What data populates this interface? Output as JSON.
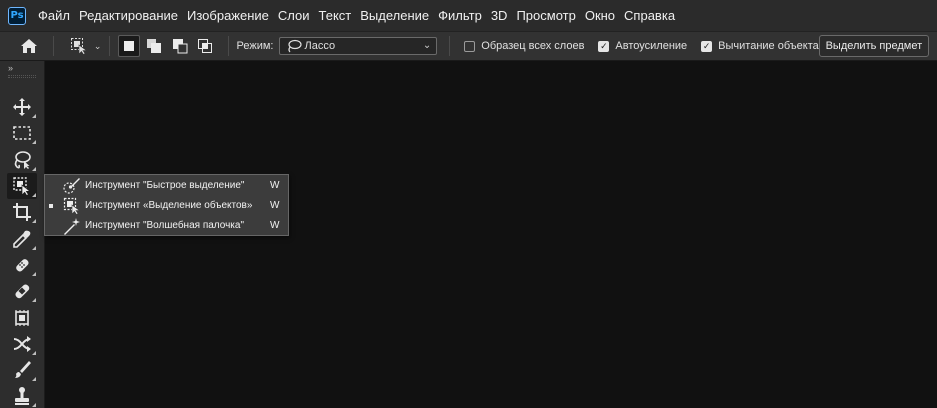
{
  "app": {
    "logo_text": "Ps"
  },
  "menu": [
    "Файл",
    "Редактирование",
    "Изображение",
    "Слои",
    "Текст",
    "Выделение",
    "Фильтр",
    "3D",
    "Просмотр",
    "Окно",
    "Справка"
  ],
  "options": {
    "mode_label": "Режим:",
    "mode_value": "Лассо",
    "sample_all_layers": {
      "label": "Образец всех слоев",
      "checked": false
    },
    "auto_enhance": {
      "label": "Автоусиление",
      "checked": true
    },
    "object_subtract": {
      "label": "Вычитание объекта",
      "checked": true
    },
    "select_subject_label": "Выделить предмет"
  },
  "toolbar": {
    "collapse_glyph": "»",
    "tools": [
      "move-tool",
      "marquee-tool",
      "lasso-tool",
      "object-selection-tool",
      "crop-tool",
      "eyedropper-tool",
      "spot-healing-tool",
      "healing-brush-tool",
      "patch-tool",
      "content-aware-move-tool",
      "brush-tool",
      "stamp-tool"
    ]
  },
  "flyout": {
    "items": [
      {
        "label": "Инструмент \"Быстрое выделение\"",
        "shortcut": "W",
        "selected": false
      },
      {
        "label": "Инструмент «Выделение объектов»",
        "shortcut": "W",
        "selected": true
      },
      {
        "label": "Инструмент \"Волшебная палочка\"",
        "shortcut": "W",
        "selected": false
      }
    ]
  },
  "colors": {
    "menubar": "#2b2b2b",
    "optionsbar": "#323232",
    "toolbar": "#2d2d2d",
    "canvas": "#111111",
    "flyout": "#3c3c3c"
  }
}
